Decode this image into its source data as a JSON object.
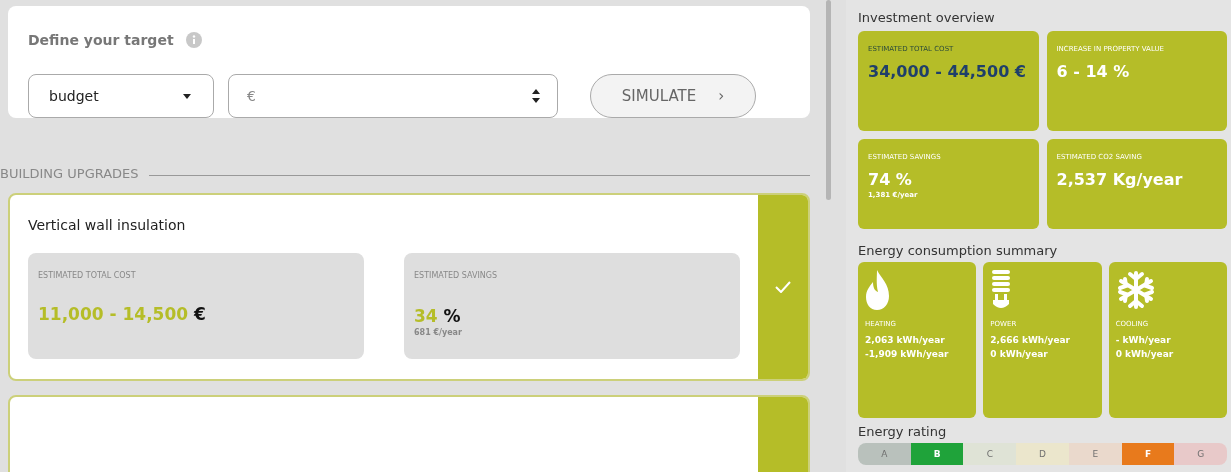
{
  "target": {
    "title": "Define your target",
    "type_select": {
      "value": "budget"
    },
    "amount_field": {
      "placeholder": "€"
    },
    "simulate_button": {
      "label": "SIMULATE",
      "arrow": "›"
    }
  },
  "upgrades": {
    "heading": "BUILDING UPGRADES",
    "items": [
      {
        "title": "Vertical wall insulation",
        "selected": true,
        "cost": {
          "label": "ESTIMATED TOTAL COST",
          "value": "11,000 - 14,500",
          "unit": "€"
        },
        "savings": {
          "label": "ESTIMATED SAVINGS",
          "value": "34",
          "unit": "%",
          "sub": "681 €/year"
        }
      },
      {
        "selected": true
      }
    ]
  },
  "overview": {
    "title": "Investment overview",
    "tiles": [
      {
        "label": "ESTIMATED TOTAL COST",
        "value": "34,000 - 44,500 €",
        "kind": "highlight"
      },
      {
        "label": "INCREASE IN PROPERTY VALUE",
        "value": "6 - 14 %",
        "kind": "plain"
      },
      {
        "label": "ESTIMATED SAVINGS",
        "value": "74 %",
        "sub": "1,381 €/year",
        "kind": "plain"
      },
      {
        "label": "ESTIMATED CO2 SAVING",
        "value": "2,537 **Kg/year**",
        "kind": "plain"
      }
    ]
  },
  "consumption": {
    "title": "Energy consumption summary",
    "tiles": [
      {
        "kind": "heating",
        "label": "HEATING",
        "lines": [
          "2,063 kWh/year",
          "-1,909 kWh/year"
        ]
      },
      {
        "kind": "power",
        "label": "POWER",
        "lines": [
          "2,666 kWh/year",
          "0 kWh/year"
        ]
      },
      {
        "kind": "cooling",
        "label": "COOLING",
        "lines": [
          "- kWh/year",
          "0 kWh/year"
        ]
      }
    ]
  },
  "rating": {
    "title": "Energy rating",
    "classes": [
      {
        "label": "A",
        "selected": false,
        "color": "#b9c1bc"
      },
      {
        "label": "B",
        "selected": true,
        "color": "#1fa33a"
      },
      {
        "label": "C",
        "selected": false,
        "color": "#dfe3d6"
      },
      {
        "label": "D",
        "selected": false,
        "color": "#ebe6cc"
      },
      {
        "label": "E",
        "selected": false,
        "color": "#ead9cc"
      },
      {
        "label": "F",
        "selected": true,
        "color": "#e87a1c"
      },
      {
        "label": "G",
        "selected": false,
        "color": "#e8c9c9"
      }
    ]
  }
}
